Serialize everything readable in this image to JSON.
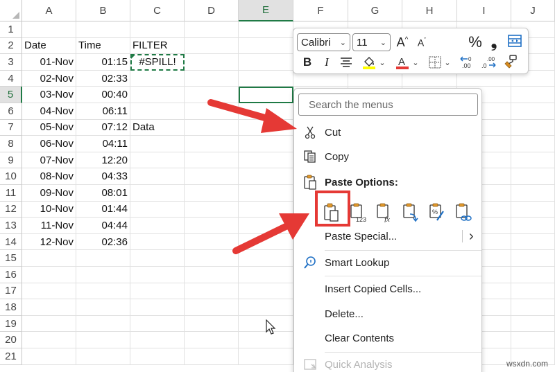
{
  "columns": [
    "A",
    "B",
    "C",
    "D",
    "E",
    "F",
    "G",
    "H",
    "I",
    "J"
  ],
  "rows": [
    "1",
    "2",
    "3",
    "4",
    "5",
    "6",
    "7",
    "8",
    "9",
    "10",
    "11",
    "12",
    "13",
    "14",
    "15",
    "16",
    "17",
    "18",
    "19",
    "20",
    "21"
  ],
  "headers": {
    "date": "Date",
    "time": "Time",
    "filter": "FILTER"
  },
  "dates": [
    "01-Nov",
    "02-Nov",
    "03-Nov",
    "04-Nov",
    "05-Nov",
    "06-Nov",
    "07-Nov",
    "08-Nov",
    "09-Nov",
    "10-Nov",
    "11-Nov",
    "12-Nov"
  ],
  "times": [
    "01:15",
    "02:33",
    "00:40",
    "06:11",
    "07:12",
    "04:11",
    "12:20",
    "04:33",
    "08:01",
    "01:44",
    "04:44",
    "02:36"
  ],
  "spill_value": "#SPILL!",
  "data_label": "Data",
  "mini_toolbar": {
    "font": "Calibri",
    "size": "11",
    "grow": "A^",
    "shrink": "A^",
    "percent": "%",
    "comma": "❟",
    "bold": "B",
    "italic": "I",
    "highlight_color": "#ffff00",
    "font_color": "#e53935"
  },
  "menu": {
    "search_placeholder": "Search the menus",
    "cut": "Cut",
    "copy": "Copy",
    "paste_options": "Paste Options:",
    "paste_special": "Paste Special...",
    "smart_lookup": "Smart Lookup",
    "insert_copied": "Insert Copied Cells...",
    "delete": "Delete...",
    "clear_contents": "Clear Contents",
    "quick_analysis": "Quick Analysis",
    "submenu_arrow": "›"
  },
  "paste_icons": [
    "paste-icon",
    "paste-values-icon",
    "paste-formulas-icon",
    "paste-transpose-icon",
    "paste-formatting-icon",
    "paste-link-icon"
  ],
  "accent_color": "#1f7a45",
  "highlight_color": "#e53935",
  "watermark": "wsxdn.com"
}
